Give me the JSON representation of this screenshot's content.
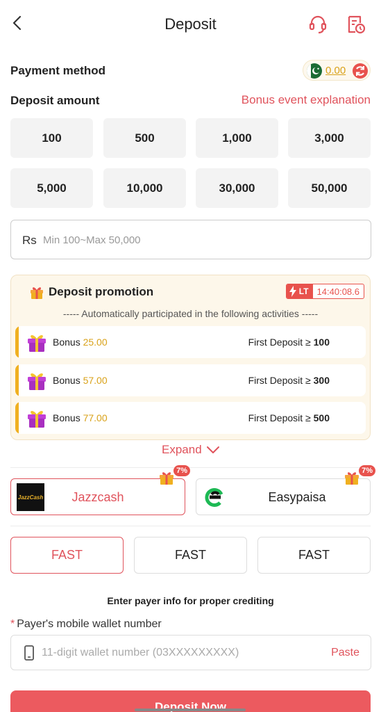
{
  "header": {
    "title": "Deposit"
  },
  "payment_method": {
    "label": "Payment method",
    "balance": "0.00"
  },
  "deposit_amount": {
    "label": "Deposit amount",
    "bonus_link": "Bonus event explanation",
    "presets": [
      "100",
      "500",
      "1,000",
      "3,000",
      "5,000",
      "10,000",
      "30,000",
      "50,000"
    ],
    "currency": "Rs",
    "placeholder": "Min 100~Max 50,000"
  },
  "promotion": {
    "title": "Deposit promotion",
    "timer_tag": "LT",
    "timer": "14:40:08.6",
    "subtitle": "----- Automatically participated in the following activities -----",
    "items": [
      {
        "label": "Bonus",
        "amount": "25.00",
        "condition": "First Deposit ≥",
        "threshold": "100"
      },
      {
        "label": "Bonus",
        "amount": "57.00",
        "condition": "First Deposit ≥",
        "threshold": "300"
      },
      {
        "label": "Bonus",
        "amount": "77.00",
        "condition": "First Deposit ≥",
        "threshold": "500"
      }
    ],
    "expand_label": "Expand"
  },
  "methods": [
    {
      "name": "Jazzcash",
      "logo_text": "JazzCash",
      "bonus_pct": "7%",
      "selected": true
    },
    {
      "name": "Easypaisa",
      "bonus_pct": "7%",
      "selected": false
    }
  ],
  "channels": [
    "FAST",
    "FAST",
    "FAST"
  ],
  "payer": {
    "hint": "Enter payer info for proper crediting",
    "required_mark": "*",
    "wallet_label": "Payer's mobile wallet number",
    "wallet_placeholder": "11-digit wallet number (03XXXXXXXXX)",
    "paste_label": "Paste"
  },
  "submit_label": "Deposit Now",
  "colors": {
    "accent": "#e0535c",
    "gold": "#d9a21a",
    "promo_bg": "#fdf7ea"
  }
}
